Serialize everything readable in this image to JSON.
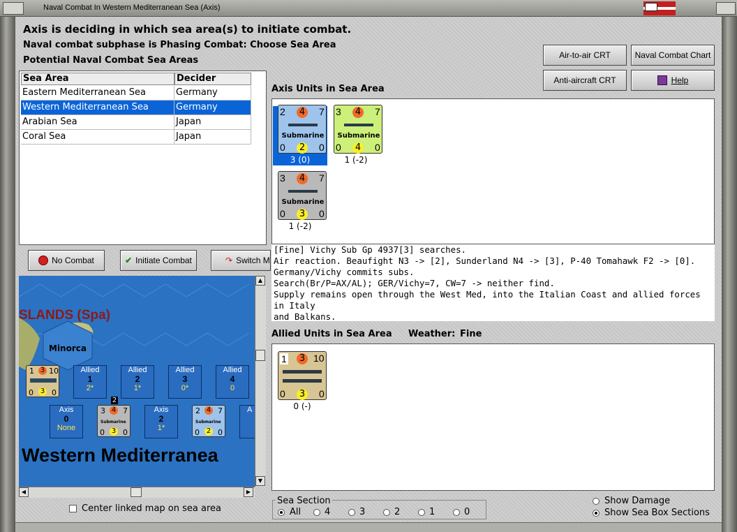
{
  "window": {
    "title": "Naval Combat In Western Mediterranean Sea (Axis)"
  },
  "header": {
    "status": "Axis is deciding in which sea area(s) to initiate combat.",
    "subphase": "Naval combat subphase is Phasing Combat: Choose Sea Area",
    "list_title": "Potential Naval Combat Sea Areas"
  },
  "toolbar": {
    "air_to_air": "Air-to-air CRT",
    "naval_chart": "Naval Combat Chart",
    "anti_aircraft": "Anti-aircraft CRT",
    "help": "Help"
  },
  "sea_table": {
    "headers": [
      "Sea Area",
      "Decider"
    ],
    "rows": [
      {
        "area": "Eastern Mediterranean Sea",
        "decider": "Germany"
      },
      {
        "area": "Western Mediterranean Sea",
        "decider": "Germany"
      },
      {
        "area": "Arabian Sea",
        "decider": "Japan"
      },
      {
        "area": "Coral Sea",
        "decider": "Japan"
      }
    ],
    "selected_row": 1
  },
  "buttons": {
    "no_combat": "No Combat",
    "initiate": "Initiate Combat",
    "switch": "Switch M"
  },
  "map": {
    "islands_label": "SLANDS (Spa)",
    "minorca": "Minorca",
    "sea_name": "Western Mediterranea",
    "allied_boxes": [
      {
        "label": "Allied",
        "num": "1",
        "sub": "2*"
      },
      {
        "label": "Allied",
        "num": "2",
        "sub": "1*"
      },
      {
        "label": "Allied",
        "num": "3",
        "sub": "0*"
      },
      {
        "label": "Allied",
        "num": "4",
        "sub": "0"
      }
    ],
    "axis_boxes": [
      {
        "label": "Axis",
        "num": "0",
        "sub": "None"
      },
      {
        "label": "Axis",
        "num": "2",
        "sub": "1*"
      },
      {
        "label": "A",
        "num": "",
        "sub": ""
      }
    ],
    "stack_count": "2"
  },
  "center_linked": "Center linked map on sea area",
  "axis_units": {
    "title": "Axis Units in Sea Area",
    "units": [
      {
        "top": [
          "2",
          "4",
          "7"
        ],
        "name": "Submarine",
        "bottom": [
          "0",
          "2",
          "0"
        ],
        "caption": "3 (0)",
        "color": "#9ec4ec",
        "selected": true
      },
      {
        "top": [
          "3",
          "4",
          "7"
        ],
        "name": "Submarine",
        "bottom": [
          "0",
          "4",
          "0"
        ],
        "caption": "1 (-2)",
        "color": "#ccf07a",
        "selected": false
      },
      {
        "top": [
          "3",
          "4",
          "7"
        ],
        "name": "Submarine",
        "bottom": [
          "0",
          "3",
          "0"
        ],
        "caption": "1 (-2)",
        "color": "#b9b9b9",
        "selected": false
      }
    ]
  },
  "log_lines": [
    "[Fine] Vichy Sub Gp 4937[3] searches.",
    "Air reaction.  Beaufight N3 -> [2], Sunderland N4 -> [3], P-40 Tomahawk F2 -> [0].",
    "Germany/Vichy commits subs.",
    "Search(Br/P=AX/AL);  GER/Vichy=7, CW=7 -> neither find.",
    "Supply remains open through the West Med, into the Italian Coast and allied forces in Italy",
    "and Balkans."
  ],
  "allied_units": {
    "title": "Allied Units in Sea Area",
    "weather_label": "Weather:",
    "weather": "Fine",
    "unit": {
      "top": [
        "1",
        "3",
        "10"
      ],
      "bottom": [
        "0",
        "3",
        "0"
      ],
      "caption": "0 (-)",
      "color": "#d8c594"
    }
  },
  "sea_section": {
    "title": "Sea Section",
    "options": [
      "All",
      "4",
      "3",
      "2",
      "1",
      "0"
    ],
    "selected": "All"
  },
  "display_options": {
    "show_damage": "Show Damage",
    "show_sections": "Show Sea Box Sections",
    "selected": "show_sections"
  },
  "colors": {
    "selection": "#0a64d8",
    "sea": "#2b72c2",
    "circle_orange": "#f06a2a",
    "circle_yellow": "#f8ee2a"
  }
}
